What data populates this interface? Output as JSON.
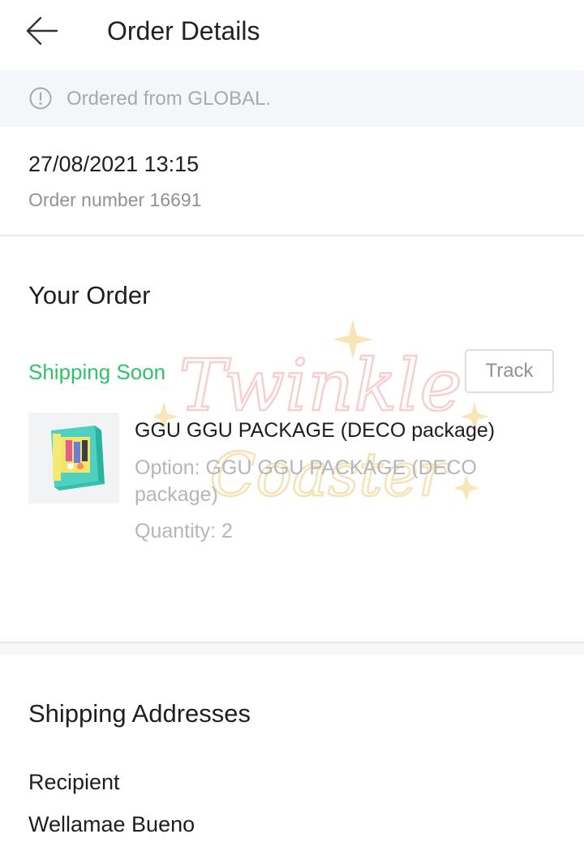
{
  "header": {
    "title": "Order Details",
    "back_icon": "arrow-left-icon"
  },
  "notice": {
    "icon": "info-icon",
    "text": "Ordered from GLOBAL."
  },
  "order": {
    "datetime": "27/08/2021 13:15",
    "number": "Order number 16691"
  },
  "your_order": {
    "title": "Your Order",
    "status": "Shipping Soon",
    "status_color": "#2fc46a",
    "track_label": "Track",
    "item": {
      "name": "GGU GGU PACKAGE (DECO package)",
      "option": "Option: GGU GGU PACKAGE (DECO package)",
      "quantity": "Quantity: 2"
    }
  },
  "shipping": {
    "title": "Shipping Addresses",
    "recipient_label": "Recipient",
    "recipient_name": "Wellamae Bueno"
  },
  "watermark": {
    "line1": "Twinkle",
    "line2": "Coaster"
  }
}
